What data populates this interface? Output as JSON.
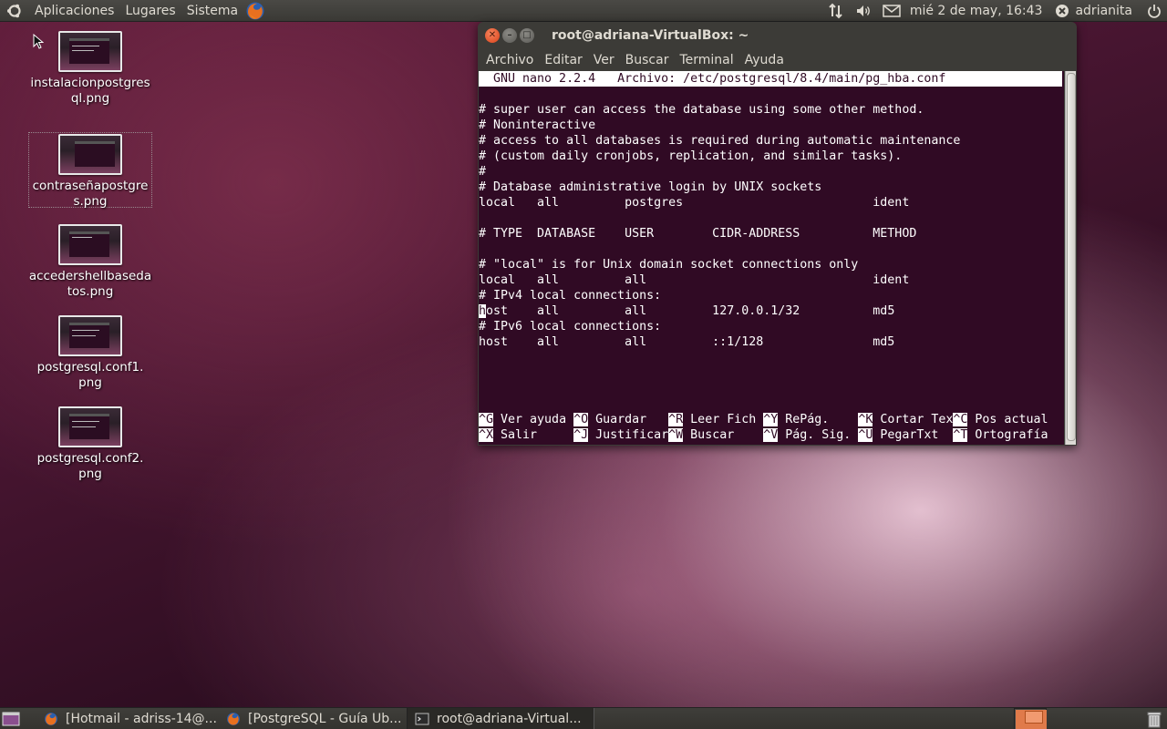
{
  "top_panel": {
    "menus": [
      "Aplicaciones",
      "Lugares",
      "Sistema"
    ],
    "clock": "mié 2 de may, 16:43",
    "user": "adrianita"
  },
  "desktop_icons": [
    {
      "line1": "instalacionpostgres",
      "line2": "ql.png"
    },
    {
      "line1": "contraseñapostgre",
      "line2": "s.png"
    },
    {
      "line1": "accedershellbaseda",
      "line2": "tos.png"
    },
    {
      "line1": "postgresql.conf1.",
      "line2": "png"
    },
    {
      "line1": "postgresql.conf2.",
      "line2": "png"
    }
  ],
  "terminal": {
    "title": "root@adriana-VirtualBox: ~",
    "menu": [
      "Archivo",
      "Editar",
      "Ver",
      "Buscar",
      "Terminal",
      "Ayuda"
    ],
    "nano_header": "  GNU nano 2.2.4   Archivo: /etc/postgresql/8.4/main/pg_hba.conf",
    "lines": [
      "# super user can access the database using some other method.",
      "# Noninteractive",
      "# access to all databases is required during automatic maintenance",
      "# (custom daily cronjobs, replication, and similar tasks).",
      "#",
      "# Database administrative login by UNIX sockets",
      "local   all         postgres                          ident",
      "",
      "# TYPE  DATABASE    USER        CIDR-ADDRESS          METHOD",
      "",
      "# \"local\" is for Unix domain socket connections only",
      "local   all         all                               ident",
      "# IPv4 local connections:",
      "ost    all         all         127.0.0.1/32          md5",
      "# IPv6 local connections:",
      "host    all         all         ::1/128               md5"
    ],
    "cursor_char": "h",
    "shortcuts_row1": [
      {
        "key": "^G",
        "label": " Ver ayuda "
      },
      {
        "key": "^O",
        "label": " Guardar   "
      },
      {
        "key": "^R",
        "label": " Leer Fich "
      },
      {
        "key": "^Y",
        "label": " RePág.    "
      },
      {
        "key": "^K",
        "label": " Cortar Tex"
      },
      {
        "key": "^C",
        "label": " Pos actual"
      }
    ],
    "shortcuts_row2": [
      {
        "key": "^X",
        "label": " Salir     "
      },
      {
        "key": "^J",
        "label": " Justificar"
      },
      {
        "key": "^W",
        "label": " Buscar    "
      },
      {
        "key": "^V",
        "label": " Pág. Sig. "
      },
      {
        "key": "^U",
        "label": " PegarTxt  "
      },
      {
        "key": "^T",
        "label": " Ortografía"
      }
    ]
  },
  "taskbar": [
    {
      "label": "[Hotmail - adriss-14@..."
    },
    {
      "label": "[PostgreSQL - Guía Ub..."
    },
    {
      "label": "root@adriana-Virtual..."
    }
  ],
  "colors": {
    "terminal_bg": "#300a24",
    "close_button": "#e0532a",
    "panel": "#3c3b37"
  }
}
